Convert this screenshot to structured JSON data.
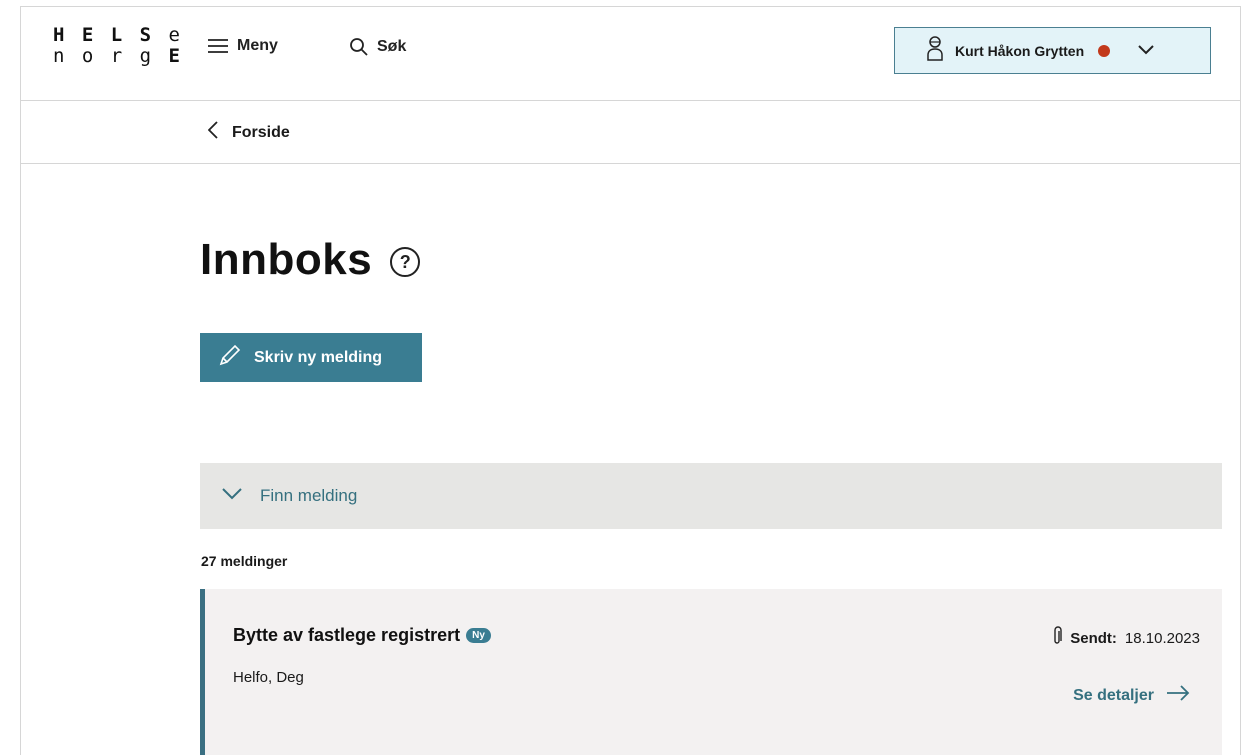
{
  "header": {
    "logo_line1_bold": "H E L S",
    "logo_line1_light": "e",
    "logo_line2_light": "n o r g",
    "logo_line2_bold": "E",
    "menu_label": "Meny",
    "search_label": "Søk",
    "user_name": "Kurt Håkon Grytten",
    "user_status_color": "#c2391b"
  },
  "breadcrumb": {
    "label": "Forside"
  },
  "page": {
    "title": "Innboks",
    "help_symbol": "?",
    "write_button_label": "Skriv ny melding",
    "find_label": "Finn melding",
    "message_count": "27 meldinger"
  },
  "messages": [
    {
      "title": "Bytte av fastlege registrert",
      "badge": "Ny",
      "sender": "Helfo, Deg",
      "sent_label": "Sendt:",
      "sent_date": "18.10.2023",
      "details_label": "Se detaljer",
      "has_attachment": true
    }
  ],
  "colors": {
    "accent": "#3a7d92",
    "accent_text": "#35707f",
    "user_box_bg": "#e3f3f8",
    "panel_bg": "#e6e6e4",
    "message_bg": "#f3f1f1"
  }
}
